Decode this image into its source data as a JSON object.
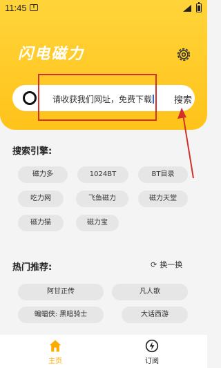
{
  "status": {
    "time": "11:45"
  },
  "header": {
    "title": "闪电磁力"
  },
  "search": {
    "query": "请收获我们网址，免费下载",
    "button_label": "搜索"
  },
  "engines": {
    "title": "搜索引擎:",
    "items": [
      "磁力多",
      "1024BT",
      "BT目录",
      "吃力网",
      "飞鱼磁力",
      "磁力天堂",
      "磁力猫",
      "磁力宝"
    ]
  },
  "hot": {
    "title": "热门推荐:",
    "refresh_label": "换一换",
    "items": [
      "阿甘正传",
      "凡人歌",
      "蝙蝠侠: 黑暗骑士",
      "大话西游"
    ]
  },
  "tabbar": {
    "home_label": "主页",
    "subscribe_label": "订阅"
  },
  "colors": {
    "accent": "#ffc31a",
    "highlight": "#d0312a",
    "active_tab": "#ffaa00"
  }
}
